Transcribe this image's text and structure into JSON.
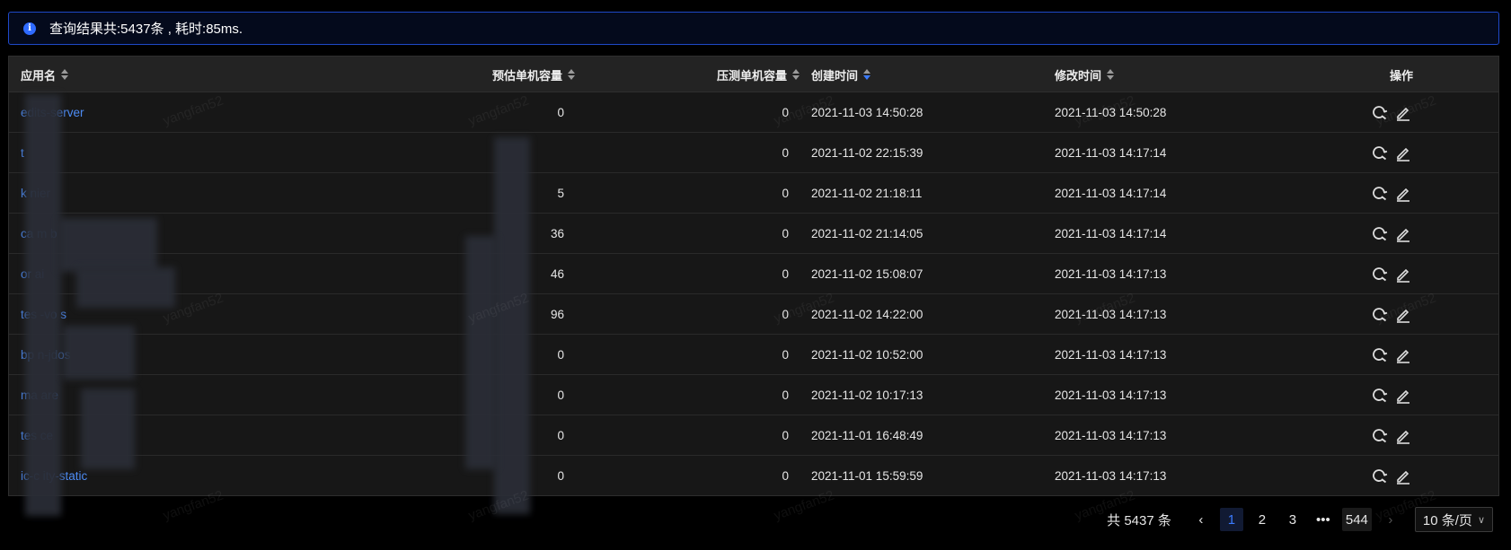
{
  "alert": {
    "text": "查询结果共:5437条 , 耗时:85ms."
  },
  "table": {
    "columns": [
      {
        "key": "app",
        "label": "应用名"
      },
      {
        "key": "estimate",
        "label": "预估单机容量"
      },
      {
        "key": "stress",
        "label": "压测单机容量"
      },
      {
        "key": "created",
        "label": "创建时间"
      },
      {
        "key": "modified",
        "label": "修改时间"
      },
      {
        "key": "ops",
        "label": "操作"
      }
    ],
    "rows": [
      {
        "app": "edits-server",
        "estimate": "0",
        "stress": "0",
        "created": "2021-11-03 14:50:28",
        "modified": "2021-11-03 14:50:28"
      },
      {
        "app": "t",
        "estimate": "",
        "stress": "0",
        "created": "2021-11-02 22:15:39",
        "modified": "2021-11-03 14:17:14"
      },
      {
        "app": "k nier",
        "estimate": "5",
        "stress": "0",
        "created": "2021-11-02 21:18:11",
        "modified": "2021-11-03 14:17:14"
      },
      {
        "app": "ca m b",
        "estimate": "36",
        "stress": "0",
        "created": "2021-11-02 21:14:05",
        "modified": "2021-11-03 14:17:14"
      },
      {
        "app": "or ai",
        "estimate": "46",
        "stress": "0",
        "created": "2021-11-02 15:08:07",
        "modified": "2021-11-03 14:17:13"
      },
      {
        "app": "tes -vo s",
        "estimate": "96",
        "stress": "0",
        "created": "2021-11-02 14:22:00",
        "modified": "2021-11-03 14:17:13"
      },
      {
        "app": "bp n-jdos",
        "estimate": "0",
        "stress": "0",
        "created": "2021-11-02 10:52:00",
        "modified": "2021-11-03 14:17:13"
      },
      {
        "app": "ma are",
        "estimate": "0",
        "stress": "0",
        "created": "2021-11-02 10:17:13",
        "modified": "2021-11-03 14:17:13"
      },
      {
        "app": "tes ce",
        "estimate": "0",
        "stress": "0",
        "created": "2021-11-01 16:48:49",
        "modified": "2021-11-03 14:17:13"
      },
      {
        "app": "ic-c ity-static",
        "estimate": "0",
        "stress": "0",
        "created": "2021-11-01 15:59:59",
        "modified": "2021-11-03 14:17:13"
      }
    ],
    "icons": {
      "stress_test": "refresh-search-icon",
      "edit": "edit-pencil-icon"
    }
  },
  "pagination": {
    "total": "共 5437 条",
    "pages": [
      "1",
      "2",
      "3",
      "544"
    ],
    "ellipsis": "•••",
    "page_size": "10 条/页",
    "current": "1"
  },
  "watermark": "yangfan52",
  "colors": {
    "link": "#4d8cf5",
    "accent": "#3b7bff",
    "alert_border": "#1f49c8"
  }
}
